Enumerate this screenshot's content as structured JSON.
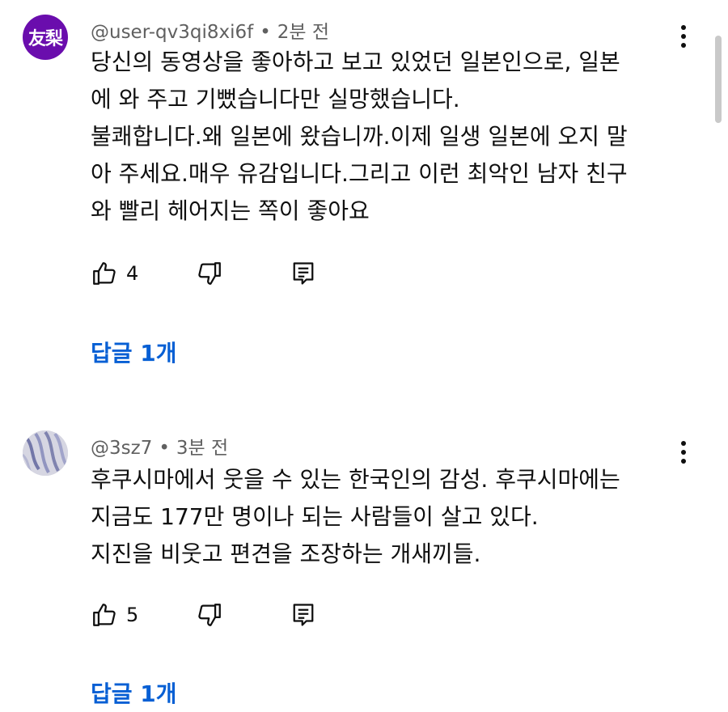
{
  "colors": {
    "avatar1_bg": "#6a0dad",
    "link": "#065fd4",
    "meta": "#606060"
  },
  "comments": [
    {
      "avatar_text": "友梨",
      "username": "@user-qv3qi8xi6f",
      "separator": "•",
      "time": "2분 전",
      "lines": [
        "당신의 동영상을 좋아하고 보고 있었던 일본인으로, 일본",
        "에 와 주고 기뻤습니다만 실망했습니다.",
        "불쾌합니다.왜 일본에 왔습니까.이제 일생 일본에 오지 말",
        "아 주세요.매우 유감입니다.그리고 이런 최악인 남자 친구",
        "와 빨리 헤어지는 쪽이 좋아요"
      ],
      "like_count": "4",
      "replies_label": "답글 1개"
    },
    {
      "avatar_text": "",
      "username": "@3sz7",
      "separator": "•",
      "time": "3분 전",
      "lines": [
        "후쿠시마에서 웃을 수 있는 한국인의 감성. 후쿠시마에는",
        "지금도 177만 명이나 되는 사람들이 살고 있다.",
        "지진을 비웃고 편견을 조장하는 개새끼들."
      ],
      "like_count": "5",
      "replies_label": "답글 1개"
    }
  ],
  "icons": {
    "like": "thumbs-up-icon",
    "dislike": "thumbs-down-icon",
    "reply": "comment-reply-icon",
    "more": "more-vert-icon"
  }
}
